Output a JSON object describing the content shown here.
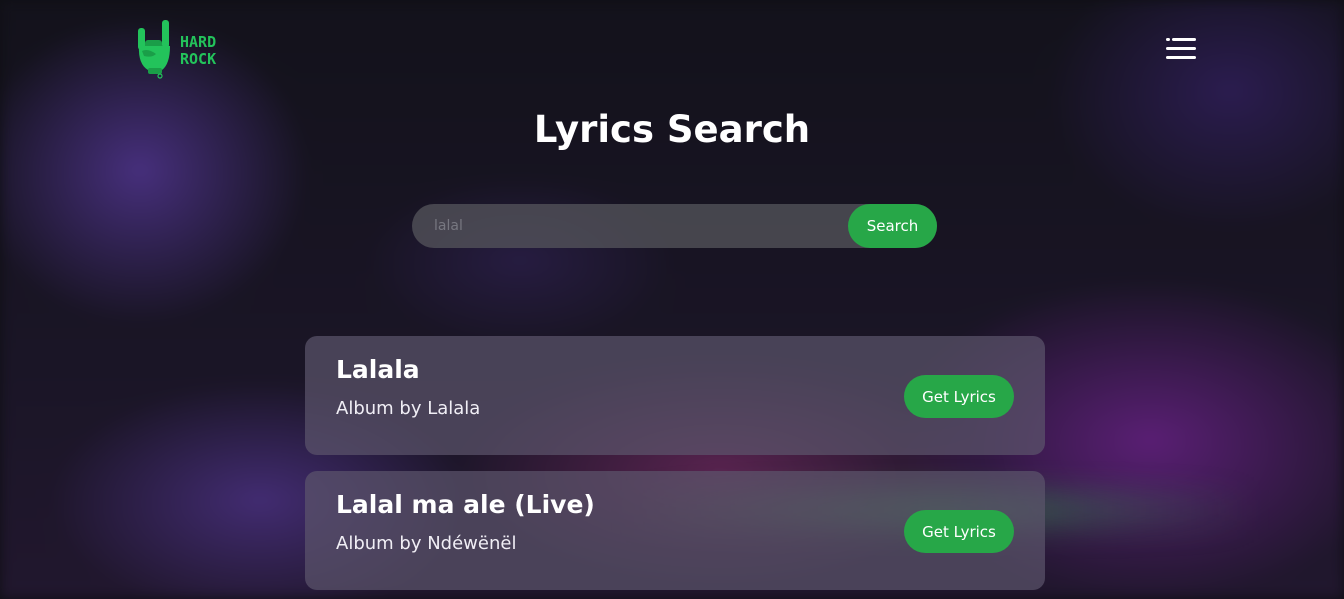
{
  "brand": {
    "logo_line1": "HARD",
    "logo_line2": "ROCK",
    "accent": "#23c35b",
    "icon": "rock-hand-icon"
  },
  "header": {
    "menu_icon": "hamburger-menu-icon"
  },
  "page": {
    "title": "Lyrics Search"
  },
  "search": {
    "value": "lalal",
    "button_label": "Search",
    "button_color": "#27a748"
  },
  "results": [
    {
      "title": "Lalala",
      "subtitle": "Album by Lalala",
      "button_label": "Get Lyrics"
    },
    {
      "title": "Lalal ma ale (Live)",
      "subtitle": "Album by Ndéwënël",
      "button_label": "Get Lyrics"
    }
  ]
}
